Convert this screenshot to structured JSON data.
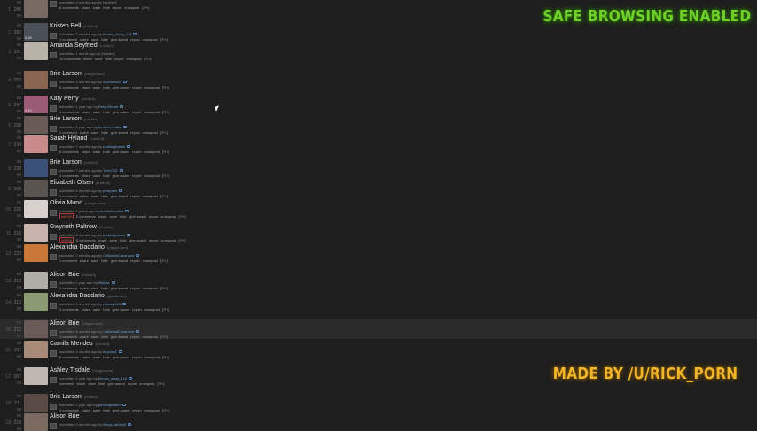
{
  "overlays": {
    "safe_browsing": "SAFE BROWSING ENABLED",
    "credit": "MADE BY /U/RICK_PORN"
  },
  "colors": {
    "background": "#1e1e1e",
    "username": "#6f9fd0",
    "safe_browsing_text": "#6fd02a",
    "credit_text": "#f0b52a",
    "nsfw": "#d24b4b"
  },
  "posts": [
    {
      "rank": "1",
      "score": "286",
      "title": "",
      "domain": "",
      "tagline": "submitted 4 months ago by [deleted]",
      "user": "",
      "buttons": [
        "6 comments",
        "share",
        "save",
        "hide",
        "report",
        "crosspost",
        "[?!+]"
      ],
      "thumb": "#7a6a64",
      "thumb_badge": ""
    },
    {
      "rank": "2",
      "score": "283",
      "title": "Kristen Bell",
      "domain": "(i.redd.it)",
      "tagline": "submitted 7 months ago by",
      "user": "thrown_away_118",
      "buttons": [
        "1 comment",
        "share",
        "save",
        "hide",
        "give award",
        "report",
        "crosspost",
        "[?!+]"
      ],
      "thumb": "#4a5058",
      "thumb_badge": "0:49"
    },
    {
      "rank": "3",
      "score": "281",
      "title": "Amanda Seyfried",
      "domain": "(i.redd.it)",
      "tagline": "submitted 1 month ago by [deleted]",
      "user": "",
      "buttons": [
        "10 comments",
        "share",
        "save",
        "hide",
        "report",
        "crosspost",
        "[?!+]"
      ],
      "thumb": "#b9b2a8",
      "thumb_badge": ""
    },
    {
      "rank": "4",
      "score": "253",
      "title": "Brie Larson",
      "domain": "(i.imgur.com)",
      "tagline": "submitted 9 months ago by",
      "user": "docmaria01",
      "buttons": [
        "6 comments",
        "share",
        "save",
        "hide",
        "give award",
        "report",
        "crosspost",
        "[?!+]"
      ],
      "thumb": "#8a6652",
      "thumb_badge": ""
    },
    {
      "rank": "5",
      "score": "247",
      "title": "Katy Perry",
      "domain": "(i.redd.it)",
      "tagline": "submitted 1 year ago by",
      "user": "RetryVtheart",
      "buttons": [
        "4 comments",
        "share",
        "save",
        "hide",
        "give award",
        "report",
        "crosspost",
        "[?!+]"
      ],
      "thumb": "#9a5a78",
      "thumb_badge": "0:10"
    },
    {
      "rank": "6",
      "score": "238",
      "title": "Brie Larson",
      "domain": "(i.redd.it)",
      "tagline": "submitted 1 year ago by",
      "user": "brotherinvodka",
      "buttons": [
        "1 comment",
        "share",
        "save",
        "hide",
        "give award",
        "report",
        "crosspost",
        "[?!+]"
      ],
      "thumb": "#6a5a56",
      "thumb_badge": ""
    },
    {
      "rank": "7",
      "score": "234",
      "title": "Sarah Hyland",
      "domain": "(i.redd.it)",
      "tagline": "submitted 7 months ago by",
      "user": "puddingtwater",
      "buttons": [
        "6 comments",
        "share",
        "save",
        "hide",
        "give award",
        "report",
        "crosspost",
        "[?!+]"
      ],
      "thumb": "#c88a8a",
      "thumb_badge": ""
    },
    {
      "rank": "8",
      "score": "230",
      "title": "Brie Larson",
      "domain": "(i.redd.it)",
      "tagline": "submitted 7 months ago by",
      "user": "Tchnr332",
      "buttons": [
        "4 comments",
        "share",
        "save",
        "hide",
        "give award",
        "report",
        "crosspost",
        "[?!+]"
      ],
      "thumb": "#3a5078",
      "thumb_badge": ""
    },
    {
      "rank": "9",
      "score": "228",
      "title": "Elizabeth Olsen",
      "domain": "(i.redd.it)",
      "tagline": "submitted 6 months ago by",
      "user": "pinkpeen",
      "buttons": [
        "1 comment",
        "share",
        "save",
        "hide",
        "give award",
        "report",
        "crosspost",
        "[?!+]"
      ],
      "thumb": "#5a5450",
      "thumb_badge": ""
    },
    {
      "rank": "10",
      "score": "226",
      "title": "Olivia Munn",
      "domain": "(i.imgur.com)",
      "tagline": "submitted 2 years ago by",
      "user": "brotherinvodka",
      "buttons": [
        "NSFW",
        "2 comments",
        "share",
        "save",
        "hide",
        "give award",
        "report",
        "crosspost",
        "[?!+]"
      ],
      "thumb": "#d8d0cc",
      "thumb_badge": ""
    },
    {
      "rank": "11",
      "score": "216",
      "title": "Gwyneth Paltrow",
      "domain": "(i.redd.it)",
      "tagline": "submitted 6 months ago by",
      "user": "puddingtwater",
      "buttons": [
        "NSFW",
        "5 comments",
        "share",
        "save",
        "hide",
        "give award",
        "report",
        "crosspost",
        "[?!+]"
      ],
      "thumb": "#c8b4ac",
      "thumb_badge": ""
    },
    {
      "rank": "12",
      "score": "223",
      "title": "Alexandra Daddario",
      "domain": "(i.imgur.com)",
      "tagline": "submitted 7 months ago by",
      "user": "CaliforniaCasanova",
      "buttons": [
        "1 comment",
        "share",
        "save",
        "hide",
        "give award",
        "report",
        "crosspost",
        "[?!+]"
      ],
      "thumb": "#c87838",
      "thumb_badge": ""
    },
    {
      "rank": "13",
      "score": "213",
      "title": "Alison Brie",
      "domain": "(i.redd.it)",
      "tagline": "submitted 1 year ago by",
      "user": "fitlegas",
      "buttons": [
        "1 comment",
        "share",
        "save",
        "hide",
        "give award",
        "report",
        "crosspost",
        "[?!+]"
      ],
      "thumb": "#b0aca8",
      "thumb_badge": ""
    },
    {
      "rank": "14",
      "score": "213",
      "title": "Alexandra Daddario",
      "domain": "(gfycat.com)",
      "tagline": "submitted 5 months ago by",
      "user": "meeory123",
      "buttons": [
        "4 comments",
        "share",
        "save",
        "hide",
        "give award",
        "report",
        "crosspost",
        "[?!+]"
      ],
      "thumb": "#8a9a72",
      "thumb_badge": ""
    },
    {
      "rank": "15",
      "score": "212",
      "title": "Alison Brie",
      "domain": "(i.imgur.com)",
      "tagline": "submitted 6 months ago by",
      "user": "CaliforniaCasanova",
      "buttons": [
        "1 comment",
        "share",
        "save",
        "hide",
        "give award",
        "report",
        "crosspost",
        "[?!+]"
      ],
      "thumb": "#6a5a58",
      "thumb_badge": ""
    },
    {
      "rank": "16",
      "score": "211",
      "title": "Camila Mendes",
      "domain": "(i.redd.it)",
      "tagline": "submitted 4 months ago by",
      "user": "furyous6",
      "buttons": [
        "6 comments",
        "share",
        "save",
        "hide",
        "give award",
        "report",
        "crosspost",
        "[?!+]"
      ],
      "thumb": "#a88a78",
      "thumb_badge": ""
    },
    {
      "rank": "17",
      "score": "207",
      "title": "Ashley Tisdale",
      "domain": "(i.imgur.com)",
      "tagline": "submitted 1 year ago by",
      "user": "thrown_away_118",
      "buttons": [
        "comment",
        "share",
        "save",
        "hide",
        "give award",
        "report",
        "crosspost",
        "[?!+]"
      ],
      "thumb": "#c0b8b0",
      "thumb_badge": ""
    },
    {
      "rank": "18",
      "score": "211",
      "title": "Brie Larson",
      "domain": "(i.redd.it)",
      "tagline": "submitted 1 year ago by",
      "user": "puddingtwater",
      "buttons": [
        "4 comments",
        "share",
        "save",
        "hide",
        "give award",
        "report",
        "crosspost",
        "[?!+]"
      ],
      "thumb": "#5a4a46",
      "thumb_badge": ""
    },
    {
      "rank": "19",
      "score": "210",
      "title": "Alison Brie",
      "domain": "",
      "tagline": "submitted 5 months ago by",
      "user": "fitlegs_added0",
      "buttons": [],
      "thumb": "#7a6a60",
      "thumb_badge": ""
    }
  ]
}
